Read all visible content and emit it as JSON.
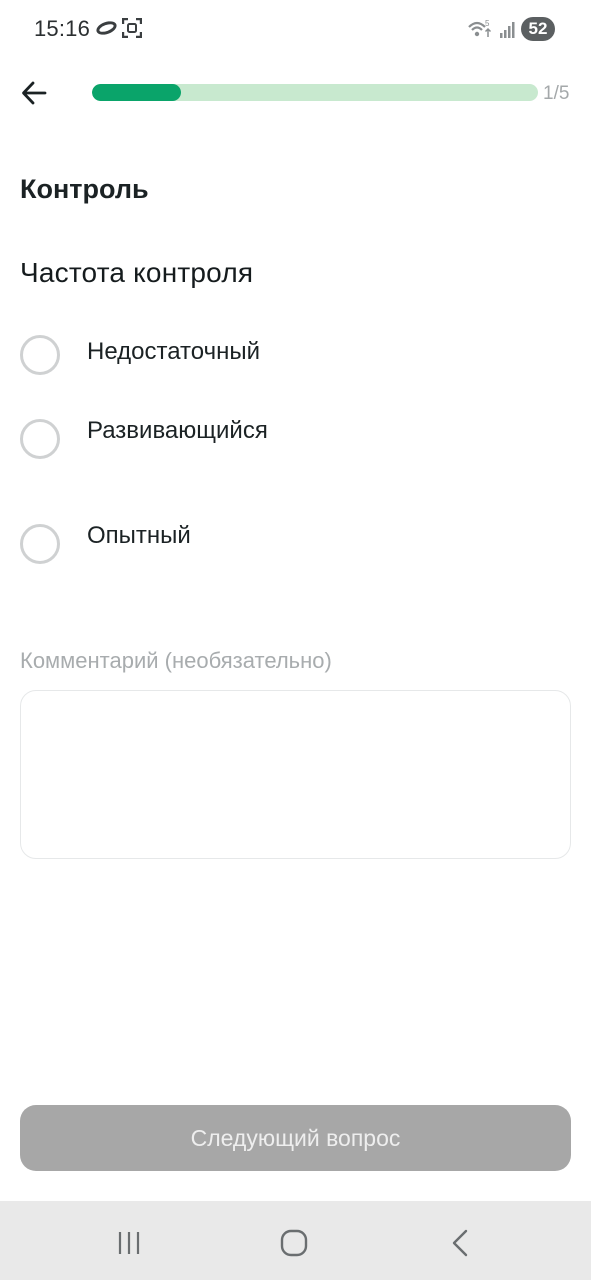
{
  "status_bar": {
    "time": "15:16",
    "battery_level": "52",
    "icons": [
      "ring-icon",
      "scan-icon",
      "wifi-icon",
      "signal-icon",
      "battery-badge"
    ]
  },
  "header": {
    "back_icon": "arrow-left-icon",
    "progress": {
      "current": 1,
      "total": 5,
      "fill_fraction": 0.2,
      "label": "1/5"
    },
    "colors": {
      "progress_fill": "#0aa46a",
      "progress_track": "#c8e9cf"
    }
  },
  "section": {
    "title": "Контроль"
  },
  "question": {
    "title": "Частота контроля",
    "options": [
      {
        "label": "Недостаточный",
        "selected": false
      },
      {
        "label": "Развивающийся",
        "selected": false
      },
      {
        "label": "Опытный",
        "selected": false
      }
    ]
  },
  "comment": {
    "label": "Комментарий (необязательно)",
    "value": ""
  },
  "next_button": {
    "label": "Следующий вопрос",
    "enabled": false,
    "color": "#a7a7a7"
  },
  "nav_bar": {
    "buttons": [
      "recent-apps-icon",
      "home-icon",
      "back-nav-icon"
    ]
  }
}
